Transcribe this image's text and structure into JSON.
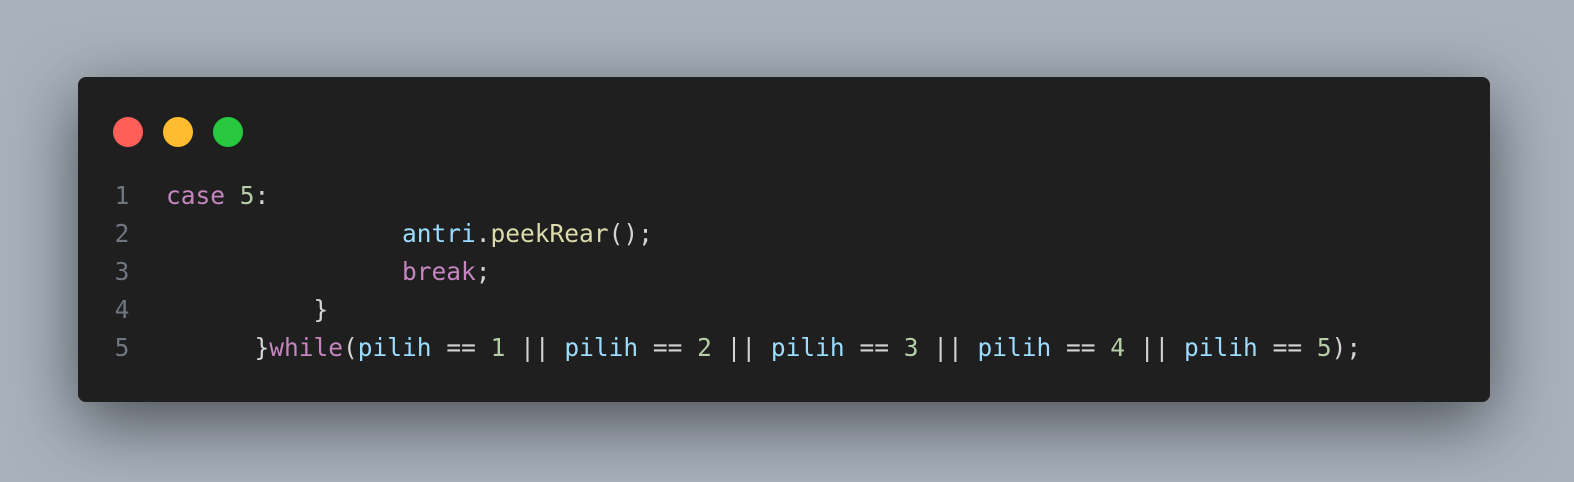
{
  "colors": {
    "background": "#a8b1bc",
    "window": "#1f1f1f",
    "dot_close": "#ff5f57",
    "dot_minimize": "#febc2e",
    "dot_maximize": "#28c840",
    "line_number": "#6e7681",
    "keyword": "#c586c0",
    "number": "#b5cea8",
    "variable": "#9cdcfe",
    "function": "#dcdcaa",
    "punct": "#d4d4d4"
  },
  "code": {
    "line_numbers": [
      "1",
      "2",
      "3",
      "4",
      "5"
    ],
    "lines": [
      [
        {
          "t": "case",
          "c": "keyword"
        },
        {
          "t": " ",
          "c": "punct"
        },
        {
          "t": "5",
          "c": "number"
        },
        {
          "t": ":",
          "c": "punct"
        }
      ],
      [
        {
          "t": "                ",
          "c": "punct"
        },
        {
          "t": "antri",
          "c": "variable"
        },
        {
          "t": ".",
          "c": "punct"
        },
        {
          "t": "peekRear",
          "c": "function"
        },
        {
          "t": "();",
          "c": "punct"
        }
      ],
      [
        {
          "t": "                ",
          "c": "punct"
        },
        {
          "t": "break",
          "c": "keyword"
        },
        {
          "t": ";",
          "c": "punct"
        }
      ],
      [
        {
          "t": "          }",
          "c": "punct"
        }
      ],
      [
        {
          "t": "      }",
          "c": "punct"
        },
        {
          "t": "while",
          "c": "keyword"
        },
        {
          "t": "(",
          "c": "punct"
        },
        {
          "t": "pilih",
          "c": "variable"
        },
        {
          "t": " == ",
          "c": "punct"
        },
        {
          "t": "1",
          "c": "number"
        },
        {
          "t": " || ",
          "c": "punct"
        },
        {
          "t": "pilih",
          "c": "variable"
        },
        {
          "t": " == ",
          "c": "punct"
        },
        {
          "t": "2",
          "c": "number"
        },
        {
          "t": " || ",
          "c": "punct"
        },
        {
          "t": "pilih",
          "c": "variable"
        },
        {
          "t": " == ",
          "c": "punct"
        },
        {
          "t": "3",
          "c": "number"
        },
        {
          "t": " || ",
          "c": "punct"
        },
        {
          "t": "pilih",
          "c": "variable"
        },
        {
          "t": " == ",
          "c": "punct"
        },
        {
          "t": "4",
          "c": "number"
        },
        {
          "t": " || ",
          "c": "punct"
        },
        {
          "t": "pilih",
          "c": "variable"
        },
        {
          "t": " == ",
          "c": "punct"
        },
        {
          "t": "5",
          "c": "number"
        },
        {
          "t": ");",
          "c": "punct"
        }
      ]
    ]
  }
}
